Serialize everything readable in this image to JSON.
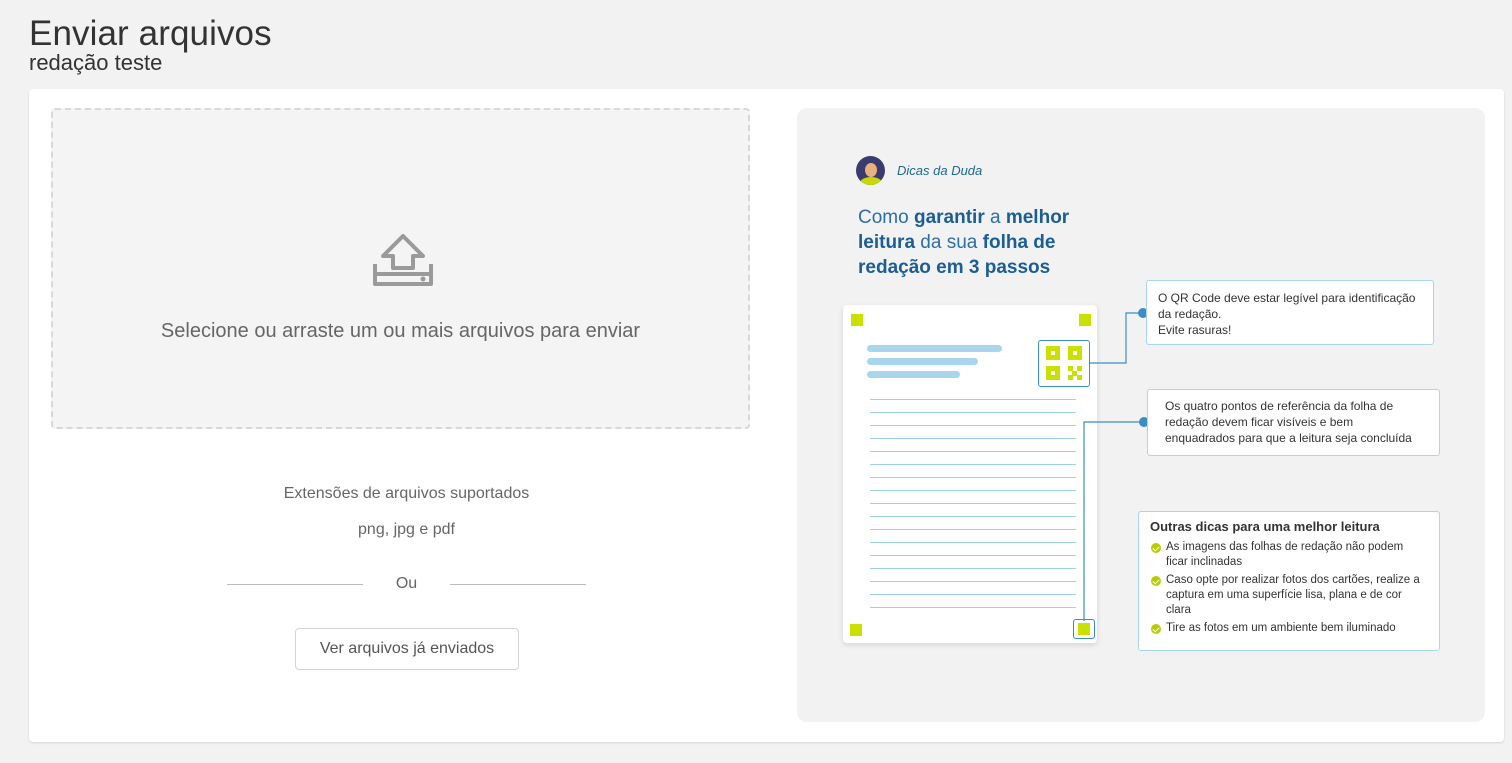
{
  "header": {
    "title": "Enviar arquivos",
    "subtitle": "redação teste"
  },
  "upload": {
    "icon": "upload-tray-icon",
    "dropzone_text": "Selecione ou arraste um ou mais arquivos para enviar",
    "extensions_label": "Extensões de arquivos suportados",
    "extensions_values": "png, jpg e pdf",
    "or_text": "Ou",
    "sent_files_button": "Ver arquivos já enviados"
  },
  "tips": {
    "author": "Dicas da Duda",
    "heading": {
      "p1": "Como ",
      "b1": "garantir",
      "p2": " a ",
      "b2": "melhor leitura",
      "p3": " da sua ",
      "b3": "folha de redação em 3 passos"
    },
    "callout_qr": {
      "line1": "O QR Code deve estar legível para identificação da redação.",
      "line2": "Evite rasuras!"
    },
    "callout_points": "Os quatro pontos de referência da folha de redação devem ficar visíveis e bem enquadrados para que a leitura seja concluída",
    "callout_tips": {
      "title": "Outras dicas para uma melhor leitura",
      "items": [
        "As imagens das folhas de redação não podem ficar inclinadas",
        "Caso opte por realizar fotos dos cartões, realize a captura em uma superfície lisa, plana e de cor clara",
        "Tire as fotos em um ambiente bem iluminado"
      ]
    }
  },
  "colors": {
    "accent_blue": "#2c6ea8",
    "marker_green": "#c9e000",
    "line_blue": "#3a8ec4"
  }
}
